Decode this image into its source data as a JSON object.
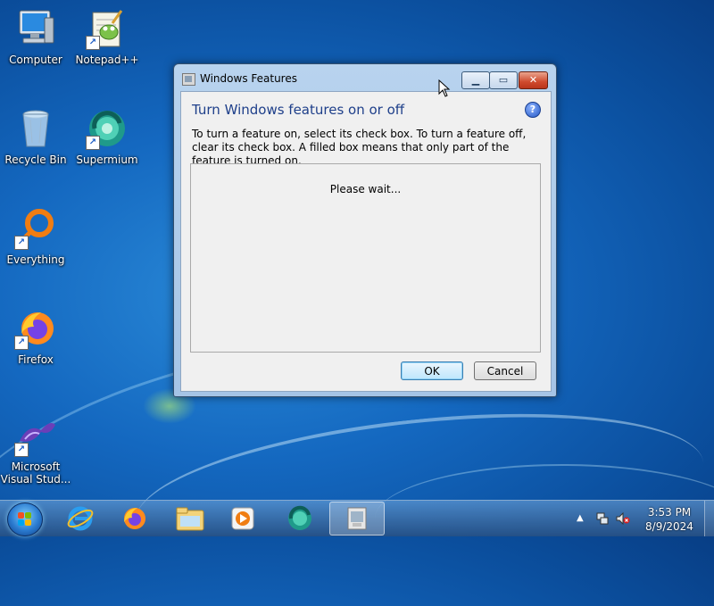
{
  "desktop": {
    "icons": [
      {
        "label": "Computer",
        "icon": "computer-icon"
      },
      {
        "label": "Notepad++",
        "icon": "notepadpp-icon",
        "shortcut": true
      },
      {
        "label": "Recycle Bin",
        "icon": "recycle-bin-icon"
      },
      {
        "label": "Supermium",
        "icon": "supermium-icon",
        "shortcut": true
      },
      {
        "label": "Everything",
        "icon": "everything-icon",
        "shortcut": true
      },
      {
        "label": "Firefox",
        "icon": "firefox-icon",
        "shortcut": true
      },
      {
        "label": "Microsoft Visual Stud...",
        "label_line1": "Microsoft",
        "label_line2": "Visual Stud...",
        "icon": "visual-studio-icon",
        "shortcut": true
      }
    ]
  },
  "window": {
    "title": "Windows Features",
    "heading": "Turn Windows features on or off",
    "description": "To turn a feature on, select its check box. To turn a feature off, clear its check box. A filled box means that only part of the feature is turned on.",
    "list_status": "Please wait...",
    "ok_label": "OK",
    "cancel_label": "Cancel",
    "help_glyph": "?"
  },
  "taskbar": {
    "items": [
      "internet-explorer-icon",
      "firefox-icon",
      "explorer-icon",
      "media-player-icon",
      "supermium-icon",
      "windows-features-icon"
    ],
    "clock_time": "3:53 PM",
    "clock_date": "8/9/2024"
  },
  "colors": {
    "heading": "#1e3f8a",
    "desktop_bg": "#1468c0"
  }
}
